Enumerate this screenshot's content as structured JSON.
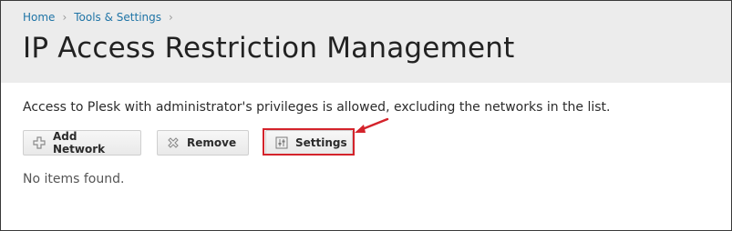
{
  "breadcrumb": {
    "items": [
      "Home",
      "Tools & Settings"
    ],
    "separator": "›"
  },
  "page_title": "IP Access Restriction Management",
  "description": "Access to Plesk with administrator's privileges is allowed, excluding the networks in the list.",
  "toolbar": {
    "add_label": "Add Network",
    "remove_label": "Remove",
    "settings_label": "Settings"
  },
  "empty_message": "No items found.",
  "colors": {
    "header_bg": "#ececec",
    "link": "#1f74a6",
    "highlight": "#d4232b"
  },
  "icons": {
    "add": "plus-icon",
    "remove": "cross-icon",
    "settings": "sliders-icon",
    "annotation": "red-arrow-icon"
  }
}
